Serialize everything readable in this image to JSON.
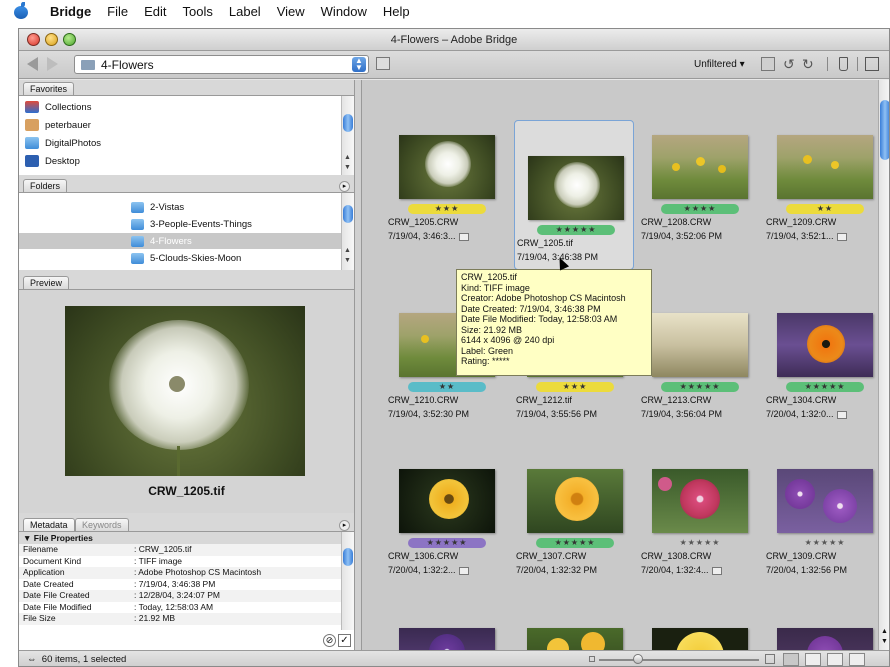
{
  "menubar": {
    "app": "Bridge",
    "items": [
      "File",
      "Edit",
      "Tools",
      "Label",
      "View",
      "Window",
      "Help"
    ]
  },
  "window": {
    "title": "4-Flowers – Adobe Bridge"
  },
  "toolbar": {
    "path": "4-Flowers",
    "filter": "Unfiltered ▾"
  },
  "favorites": {
    "tab": "Favorites",
    "items": [
      "Collections",
      "peterbauer",
      "DigitalPhotos",
      "Desktop"
    ]
  },
  "folders": {
    "tab": "Folders",
    "items": [
      "2-Vistas",
      "3-People-Events-Things",
      "4-Flowers",
      "5-Clouds-Skies-Moon"
    ],
    "selected": "4-Flowers"
  },
  "preview": {
    "tab": "Preview",
    "filename": "CRW_1205.tif"
  },
  "metadata": {
    "tab": "Metadata",
    "tab2": "Keywords",
    "section": "▼ File Properties",
    "rows": [
      {
        "k": "Filename",
        "v": ": CRW_1205.tif"
      },
      {
        "k": "Document Kind",
        "v": ": TIFF image"
      },
      {
        "k": "Application",
        "v": ": Adobe Photoshop CS Macintosh"
      },
      {
        "k": "Date Created",
        "v": ": 7/19/04, 3:46:38 PM"
      },
      {
        "k": "Date File Created",
        "v": ": 12/28/04, 3:24:07 PM"
      },
      {
        "k": "Date File Modified",
        "v": ": Today, 12:58:03 AM"
      },
      {
        "k": "File Size",
        "v": ": 21.92 MB"
      }
    ]
  },
  "thumbnails": [
    {
      "name": "CRW_1205.CRW",
      "date": "7/19/04, 3:46:3...",
      "stars": "★★★",
      "label": "yellow"
    },
    {
      "name": "CRW_1205.tif",
      "date": "7/19/04, 3:46:38 PM",
      "stars": "★★★★★",
      "label": "green"
    },
    {
      "name": "CRW_1208.CRW",
      "date": "7/19/04, 3:52:06 PM",
      "stars": "★★★★",
      "label": "green"
    },
    {
      "name": "CRW_1209.CRW",
      "date": "7/19/04, 3:52:1...",
      "stars": "★★",
      "label": "yellow"
    },
    {
      "name": "CRW_1210.CRW",
      "date": "7/19/04, 3:52:30 PM",
      "stars": "★★",
      "label": "blue"
    },
    {
      "name": "CRW_1212.tif",
      "date": "7/19/04, 3:55:56 PM",
      "stars": "★★★",
      "label": "yellow"
    },
    {
      "name": "CRW_1213.CRW",
      "date": "7/19/04, 3:56:04 PM",
      "stars": "★★★★★",
      "label": "green"
    },
    {
      "name": "CRW_1304.CRW",
      "date": "7/20/04, 1:32:0...",
      "stars": "★★★★★",
      "label": "green"
    },
    {
      "name": "CRW_1306.CRW",
      "date": "7/20/04, 1:32:2...",
      "stars": "★★★★★",
      "label": "purple"
    },
    {
      "name": "CRW_1307.CRW",
      "date": "7/20/04, 1:32:32 PM",
      "stars": "★★★★★",
      "label": "green"
    },
    {
      "name": "CRW_1308.CRW",
      "date": "7/20/04, 1:32:4...",
      "stars": "★★★★★",
      "label": "none"
    },
    {
      "name": "CRW_1309.CRW",
      "date": "7/20/04, 1:32:56 PM",
      "stars": "★★★★★",
      "label": "none"
    }
  ],
  "tooltip": {
    "lines": [
      "CRW_1205.tif",
      "Kind: TIFF image",
      "Creator: Adobe Photoshop CS Macintosh",
      "Date Created: 7/19/04, 3:46:38 PM",
      "Date File Modified: Today, 12:58:03 AM",
      "Size: 21.92 MB",
      "6144 x 4096 @ 240 dpi",
      "Label: Green",
      "Rating: *****"
    ]
  },
  "statusbar": {
    "status": "60 items, 1 selected"
  }
}
